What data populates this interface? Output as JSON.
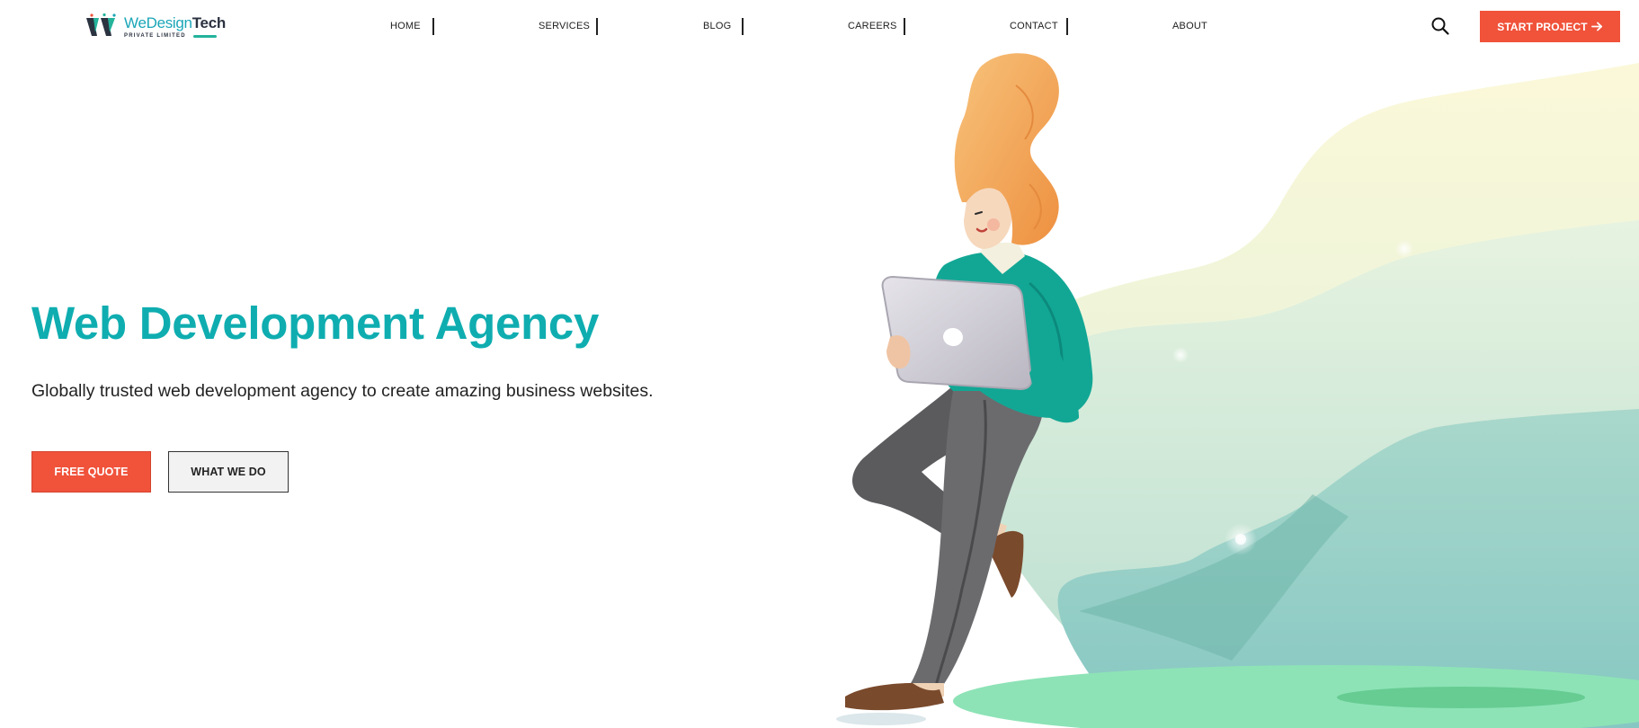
{
  "brand": {
    "name_light": "WeDesign",
    "name_bold": "Tech",
    "tagline": "PRIVATE LIMITED",
    "logo_icon": "wdt-logo-icon"
  },
  "nav": {
    "items": [
      {
        "label": "HOME"
      },
      {
        "label": "SERVICES"
      },
      {
        "label": "BLOG"
      },
      {
        "label": "CAREERS"
      },
      {
        "label": "CONTACT"
      },
      {
        "label": "ABOUT"
      }
    ],
    "search_icon": "search-icon",
    "cta_label": "START PROJECT",
    "cta_icon": "arrow-right-icon"
  },
  "hero": {
    "title": "Web Development Agency",
    "subtitle": "Globally trusted web development agency to create amazing business websites.",
    "primary_button": "FREE QUOTE",
    "secondary_button": "WHAT WE DO",
    "illustration": "woman-with-laptop-illustration"
  },
  "colors": {
    "accent": "#f0523a",
    "title_teal": "#0fadb0",
    "sweater": "#12a795",
    "hair": "#f2a85c",
    "background_wave_light": "#fbf7d8",
    "background_wave_dark": "#7fc9c0",
    "ground": "#8de3b6"
  }
}
